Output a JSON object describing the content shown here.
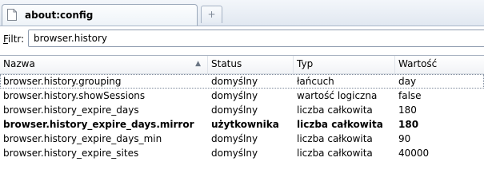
{
  "tab": {
    "title": "about:config",
    "icon": "page-icon",
    "new_tab_symbol": "+"
  },
  "filter": {
    "label_accesskey": "F",
    "label_rest": "iltr:",
    "value": "browser.history"
  },
  "table": {
    "columns": [
      {
        "label": "Nazwa",
        "sorted": "ascending"
      },
      {
        "label": "Status"
      },
      {
        "label": "Typ"
      },
      {
        "label": "Wartość"
      }
    ],
    "rows": [
      {
        "name": "browser.history.grouping",
        "status": "domyślny",
        "type": "łańcuch",
        "value": "day",
        "modified": false
      },
      {
        "name": "browser.history.showSessions",
        "status": "domyślny",
        "type": "wartość logiczna",
        "value": "false",
        "modified": false
      },
      {
        "name": "browser.history_expire_days",
        "status": "domyślny",
        "type": "liczba całkowita",
        "value": "180",
        "modified": false
      },
      {
        "name": "browser.history_expire_days.mirror",
        "status": "użytkownika",
        "type": "liczba całkowita",
        "value": "180",
        "modified": true
      },
      {
        "name": "browser.history_expire_days_min",
        "status": "domyślny",
        "type": "liczba całkowita",
        "value": "90",
        "modified": false
      },
      {
        "name": "browser.history_expire_sites",
        "status": "domyślny",
        "type": "liczba całkowita",
        "value": "40000",
        "modified": false
      }
    ]
  }
}
